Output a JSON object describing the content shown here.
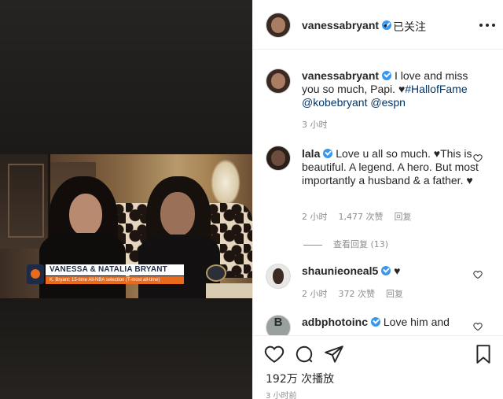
{
  "media": {
    "lower_third_name": "VANESSA & NATALIA BRYANT",
    "lower_third_sub": "K. Bryant: 15-time All-NBA selection (T-most all-time)"
  },
  "header": {
    "username": "vanessabryant",
    "separator": "•",
    "follow_status": "已关注",
    "more_icon": "more-horizontal-icon"
  },
  "caption": {
    "username": "vanessabryant",
    "text": "I love and miss you so much, Papi. ",
    "heart": "♥",
    "hashtag": "#HallofFame",
    "mention1": "@kobebryant",
    "mention2": "@espn",
    "time": "3 小时"
  },
  "comments": [
    {
      "username": "lala",
      "text": "Love u all so much. ♥This is beautiful. A legend. A hero. But most importantly a husband & a father. ♥",
      "time": "2 小时",
      "likes": "1,477 次赞",
      "reply": "回复",
      "view_replies": "查看回复 (13)"
    },
    {
      "username": "shaunieoneal5",
      "text": "♥",
      "time": "2 小时",
      "likes": "372 次赞",
      "reply": "回复"
    },
    {
      "username": "adbphotoinc",
      "text": "Love him and",
      "avatar_letter": "B"
    }
  ],
  "actions": {
    "icons": [
      "heart-icon",
      "comment-icon",
      "share-icon",
      "bookmark-icon"
    ],
    "views": "192万 次播放",
    "posted": "3 小时前"
  }
}
